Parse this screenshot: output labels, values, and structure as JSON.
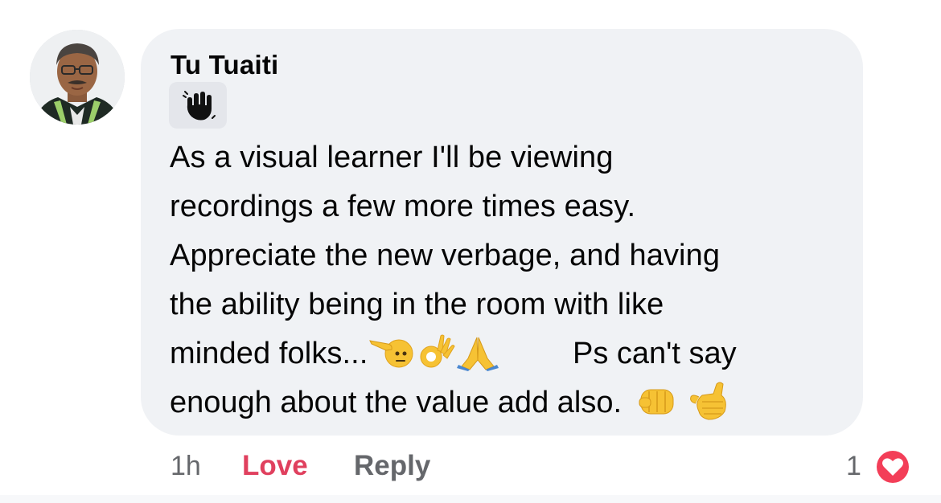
{
  "comment": {
    "author": "Tu Tuaiti",
    "badge_icon": "waving-hand-icon",
    "text_lines": [
      "As a visual learner I'll be viewing",
      "recordings a few more times easy.",
      "Appreciate the new verbage, and having",
      "the ability being in the room with like"
    ],
    "line5_text_a": "minded folks...",
    "line5_text_b": "Ps can't say",
    "line6_text": "enough about the value add also.",
    "emojis": [
      "saluting-face",
      "ok-hand",
      "folded-hands",
      "oncoming-fist",
      "call-me-hand"
    ]
  },
  "footer": {
    "timestamp": "1h",
    "love_label": "Love",
    "reply_label": "Reply",
    "reaction_count": "1",
    "reaction_icon": "heart-reaction-icon"
  },
  "colors": {
    "bubble": "#f0f2f5",
    "love": "#e0405e",
    "muted": "#65676b",
    "heart": "#f33e58"
  }
}
